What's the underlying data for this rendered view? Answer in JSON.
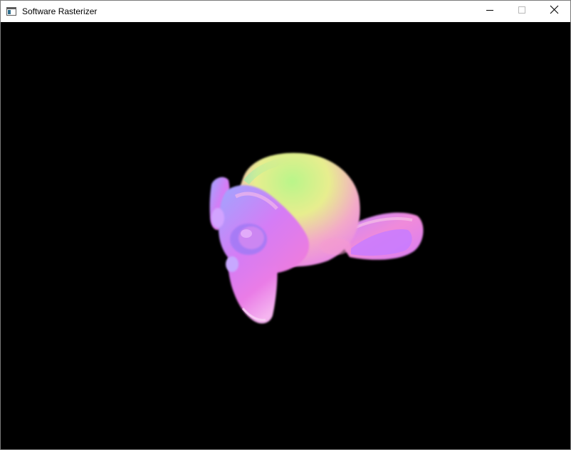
{
  "window": {
    "title": "Software Rasterizer",
    "icon": "app-window-icon"
  },
  "caption_buttons": {
    "minimize_icon": "minimize-icon",
    "maximize_icon": "maximize-icon",
    "close_icon": "close-icon"
  },
  "viewport": {
    "background": "#000000",
    "content": "normal-shaded-monkey-head-mesh"
  }
}
